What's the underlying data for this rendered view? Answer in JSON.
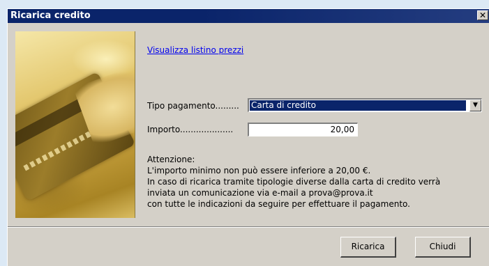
{
  "window": {
    "title": "Ricarica credito",
    "close_symbol": "✕"
  },
  "link": {
    "price_list": "Visualizza listino prezzi"
  },
  "form": {
    "payment_label": "Tipo pagamento.........",
    "payment_value": "Carta di credito",
    "amount_label": "Importo....................",
    "amount_value": "20,00"
  },
  "notice": {
    "line1": "Attenzione:",
    "line2": "L'importo minimo non può essere inferiore a 20,00 €.",
    "line3": "In caso di ricarica tramite tipologie diverse dalla carta di credito verrà",
    "line4": "inviata un comunicazione via e-mail a prova@prova.it",
    "line5": "con tutte le indicazioni da seguire per effettuare il pagamento."
  },
  "buttons": {
    "recharge": "Ricarica",
    "close": "Chiudi"
  },
  "icons": {
    "dropdown": "chevron-down-icon",
    "close": "close-icon"
  }
}
